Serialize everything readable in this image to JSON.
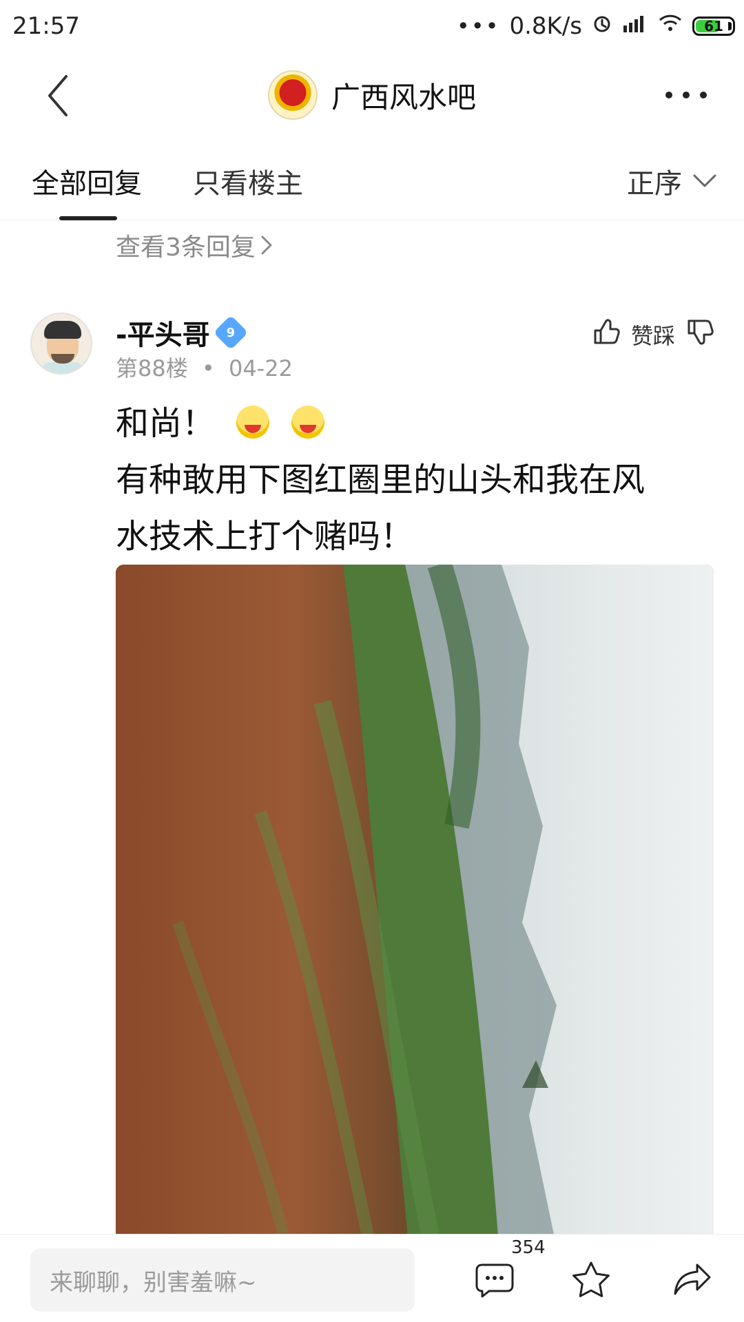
{
  "status_bar": {
    "time": "21:57",
    "network_speed": "0.8K/s",
    "battery": "61",
    "icons": [
      "more-dots-icon",
      "alarm-icon",
      "signal-icon",
      "wifi-icon",
      "battery-icon"
    ]
  },
  "header": {
    "title": "广西风水吧",
    "back_icon": "chevron-left-icon",
    "more_icon": "more-horizontal-icon"
  },
  "tabs": {
    "all_replies": "全部回复",
    "op_only": "只看楼主",
    "sort_label": "正序"
  },
  "feed": {
    "view_replies": "查看3条回复",
    "post": {
      "username": "-平头哥",
      "level": "9",
      "floor": "第88楼",
      "separator": "•",
      "date": "04-22",
      "vote_label": "赞踩",
      "lines": [
        "和尚！",
        "有种敢用下图红圈里的山头和我在风",
        "水技术上打个赌吗！"
      ]
    }
  },
  "bottom_bar": {
    "input_placeholder": "来聊聊，别害羞嘛~",
    "comment_count": "354"
  },
  "colors": {
    "accent_blue": "#57a7ff",
    "text_primary": "#111111",
    "text_secondary": "#9a9a9a"
  }
}
